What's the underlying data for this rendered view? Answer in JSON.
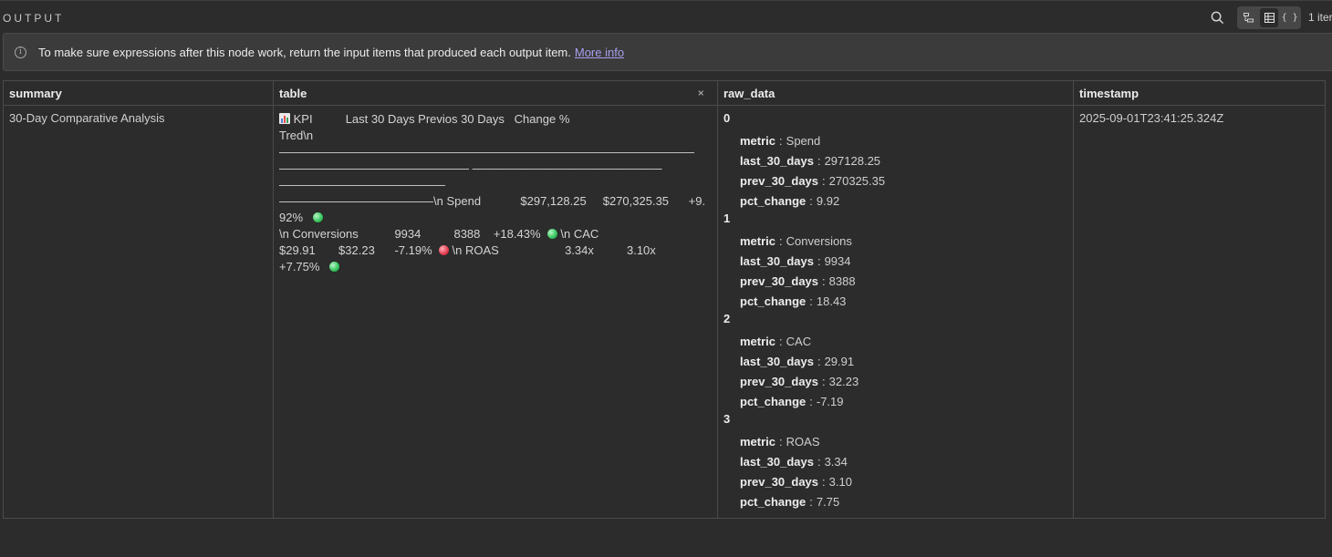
{
  "panel": {
    "title": "OUTPUT",
    "items_count": "1 iter"
  },
  "icons": {
    "search": "search-icon",
    "view_schema": "schema-view-icon",
    "view_table": "table-view-icon",
    "view_json": "json-view-icon",
    "info": "info-icon"
  },
  "notice": {
    "message": "To make sure expressions after this node work, return the input items that produced each output item.",
    "link": "More info"
  },
  "columns": [
    "summary",
    "table",
    "raw_data",
    "timestamp"
  ],
  "row": {
    "summary": "30-Day Comparative Analysis",
    "table": {
      "header": "KPI          Last 30 Days Previos 30 Days   Change %",
      "line2": "Tred\\n———————————————————————————————————",
      "line3": "———————————————— ———————————————— ——————————————",
      "line4": "—————————————\\n Spend            $297,128.25     $270,325.35      +9.92%",
      "line5": "\\n Conversions           9934          8388    +18.43%",
      "line5b": "\\n CAC",
      "line6": "$29.91       $32.23      -7.19%",
      "line6b": "\\n ROAS                    3.34x          3.10x",
      "line7": "+7.75%"
    },
    "timestamp": "2025-09-01T23:41:25.324Z"
  },
  "raw_data": [
    {
      "index": "0",
      "metric": "Spend",
      "last_30_days": "297128.25",
      "prev_30_days": "270325.35",
      "pct_change": "9.92"
    },
    {
      "index": "1",
      "metric": "Conversions",
      "last_30_days": "9934",
      "prev_30_days": "8388",
      "pct_change": "18.43"
    },
    {
      "index": "2",
      "metric": "CAC",
      "last_30_days": "29.91",
      "prev_30_days": "32.23",
      "pct_change": "-7.19"
    },
    {
      "index": "3",
      "metric": "ROAS",
      "last_30_days": "3.34",
      "prev_30_days": "3.10",
      "pct_change": "7.75"
    }
  ],
  "raw_keys": {
    "metric": "metric",
    "last": "last_30_days",
    "prev": "prev_30_days",
    "pct": "pct_change"
  },
  "colors": {
    "accent_link": "#a99ef0",
    "up": "#33c45a",
    "down": "#e33a4c"
  }
}
